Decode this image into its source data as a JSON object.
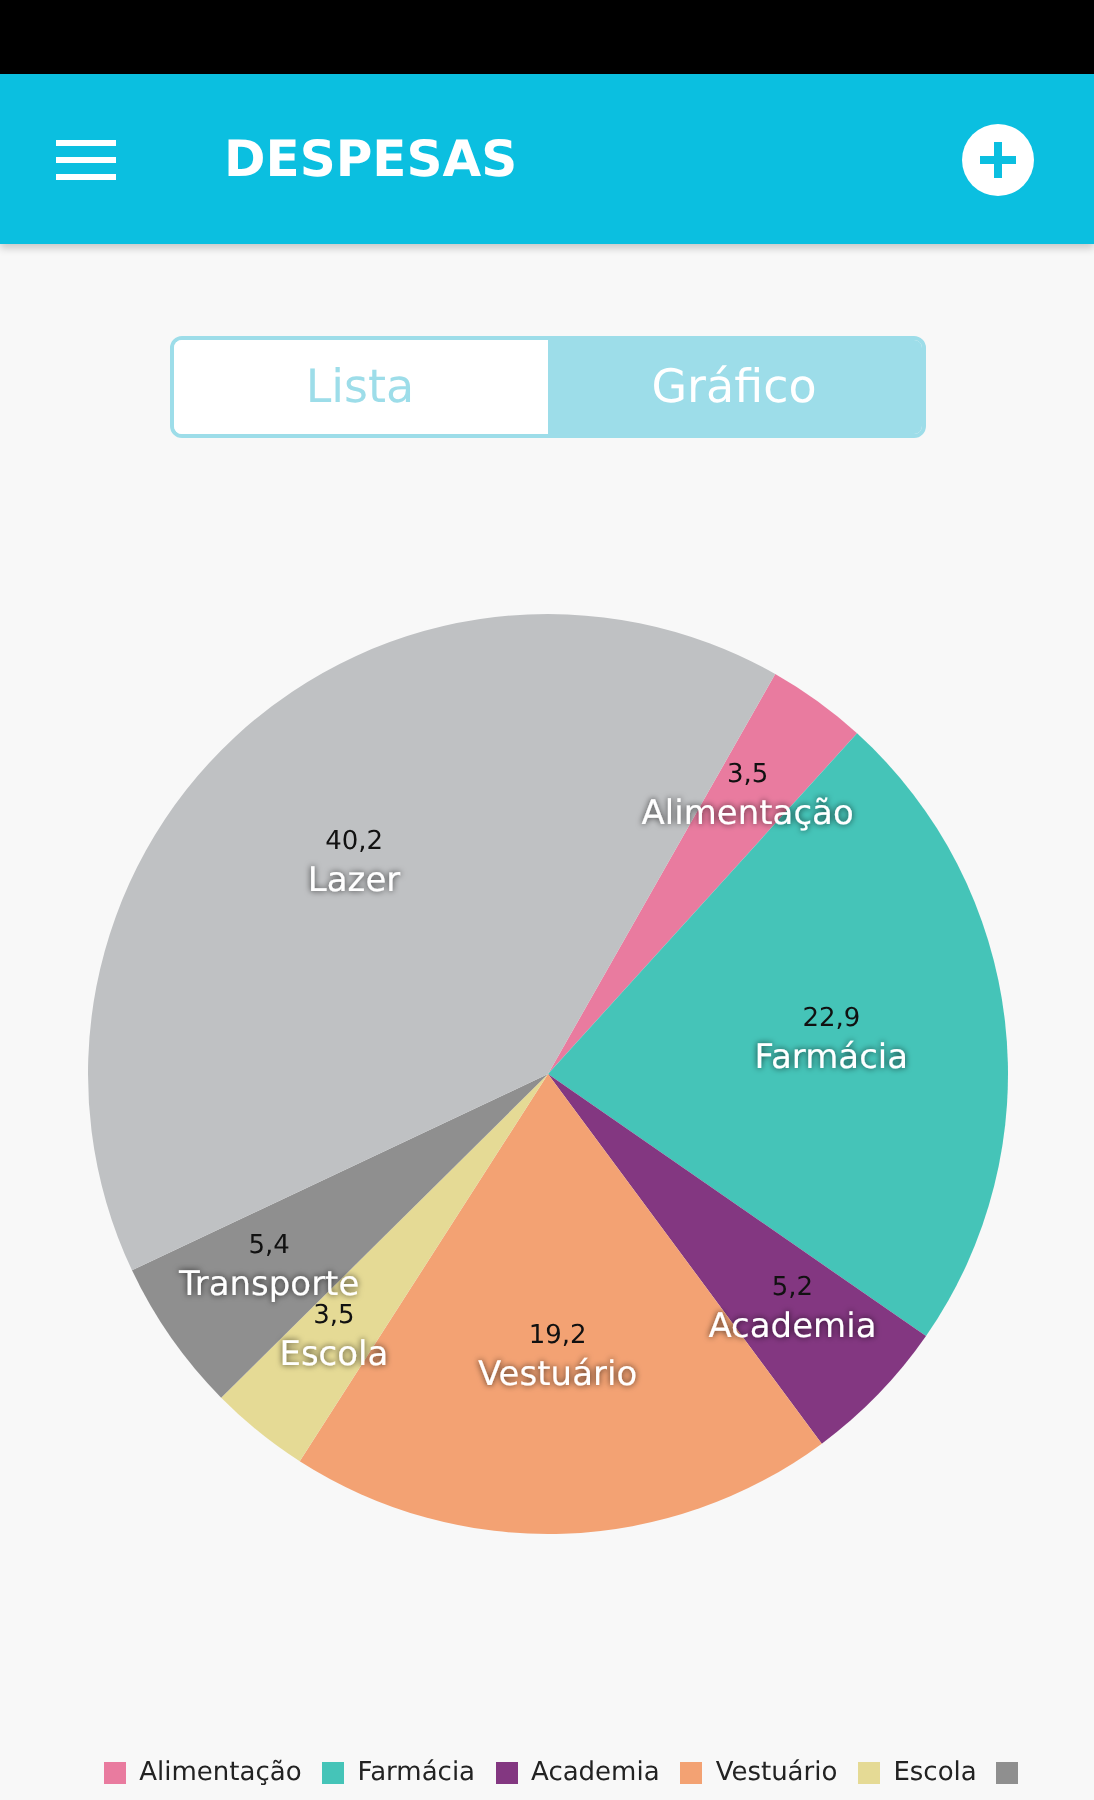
{
  "app_bar": {
    "title": "DESPESAS"
  },
  "view_toggle": [
    {
      "label": "Lista",
      "selected": false
    },
    {
      "label": "Gráfico",
      "selected": true
    }
  ],
  "chart_data": {
    "type": "pie",
    "categories": [
      "Alimentação",
      "Farmácia",
      "Academia",
      "Vestuário",
      "Escola",
      "Transporte",
      "Lazer"
    ],
    "values": [
      3.5,
      22.9,
      5.2,
      19.2,
      3.5,
      5.4,
      40.2
    ],
    "colors": [
      "#e97b9f",
      "#45c4b8",
      "#833781",
      "#f3a273",
      "#e5da95",
      "#8f8f8f",
      "#bfc1c3"
    ],
    "value_labels": [
      "3,5",
      "22,9",
      "5,2",
      "19,2",
      "3,5",
      "5,4",
      "40,2"
    ]
  },
  "legend": [
    {
      "label": "Alimentação",
      "color": "#e97b9f"
    },
    {
      "label": "Farmácia",
      "color": "#45c4b8"
    },
    {
      "label": "Academia",
      "color": "#833781"
    },
    {
      "label": "Vestuário",
      "color": "#f3a273"
    },
    {
      "label": "Escola",
      "color": "#e5da95"
    },
    {
      "color": "#8f8f8f"
    }
  ]
}
